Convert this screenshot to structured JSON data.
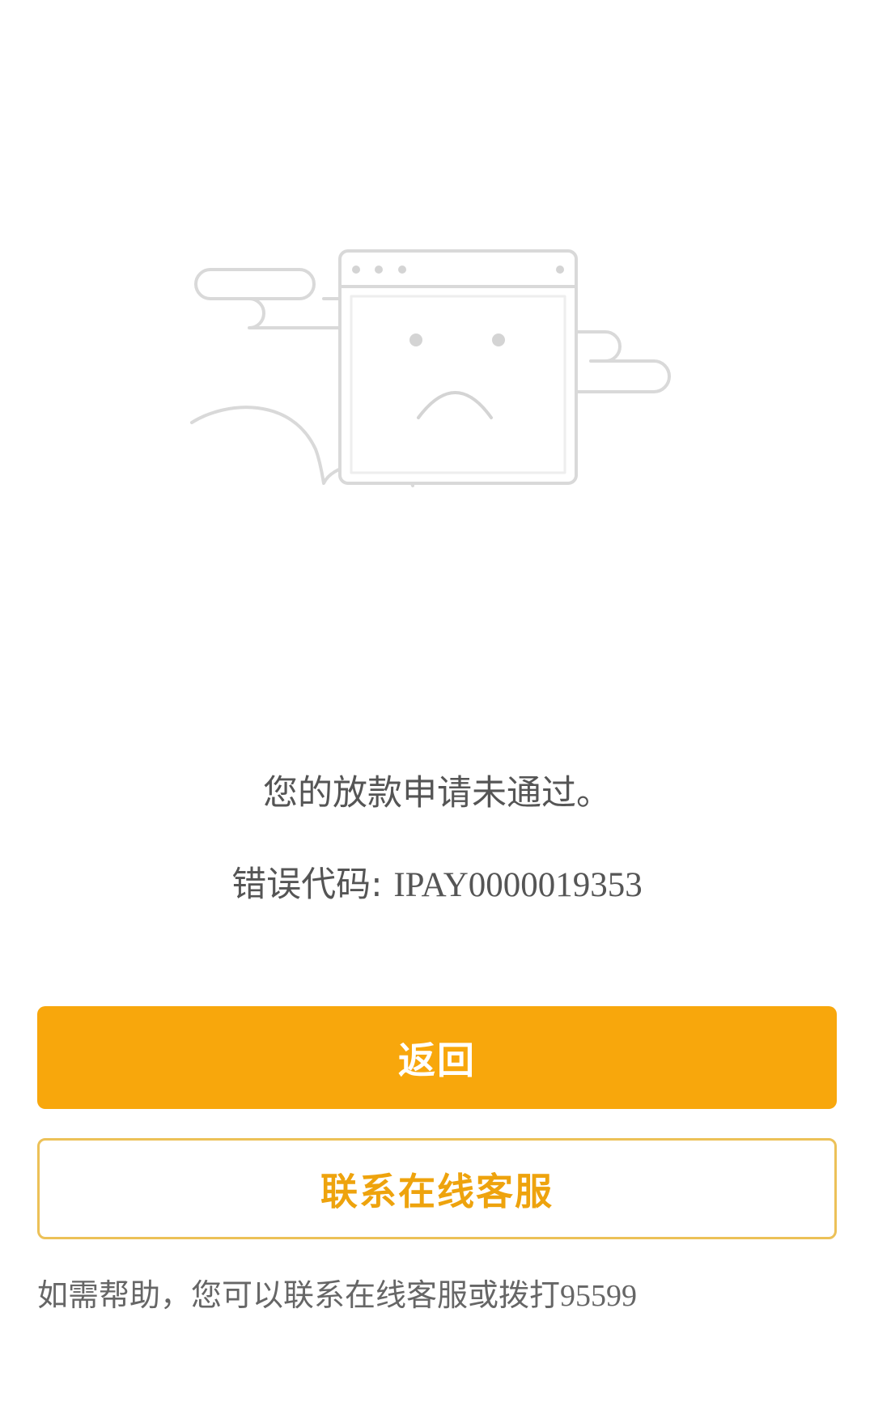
{
  "illustration": {
    "description_icon": "sad-browser-window-icon"
  },
  "message": "您的放款申请未通过。",
  "error": {
    "label": "错误代码:",
    "code": "IPAY0000019353"
  },
  "buttons": {
    "back_label": "返回",
    "service_label": "联系在线客服"
  },
  "help": {
    "text": "如需帮助，您可以联系在线客服或拨打",
    "phone": "95599"
  },
  "colors": {
    "accent": "#f8a70c",
    "outline": "#ecc158",
    "text": "#555555"
  }
}
